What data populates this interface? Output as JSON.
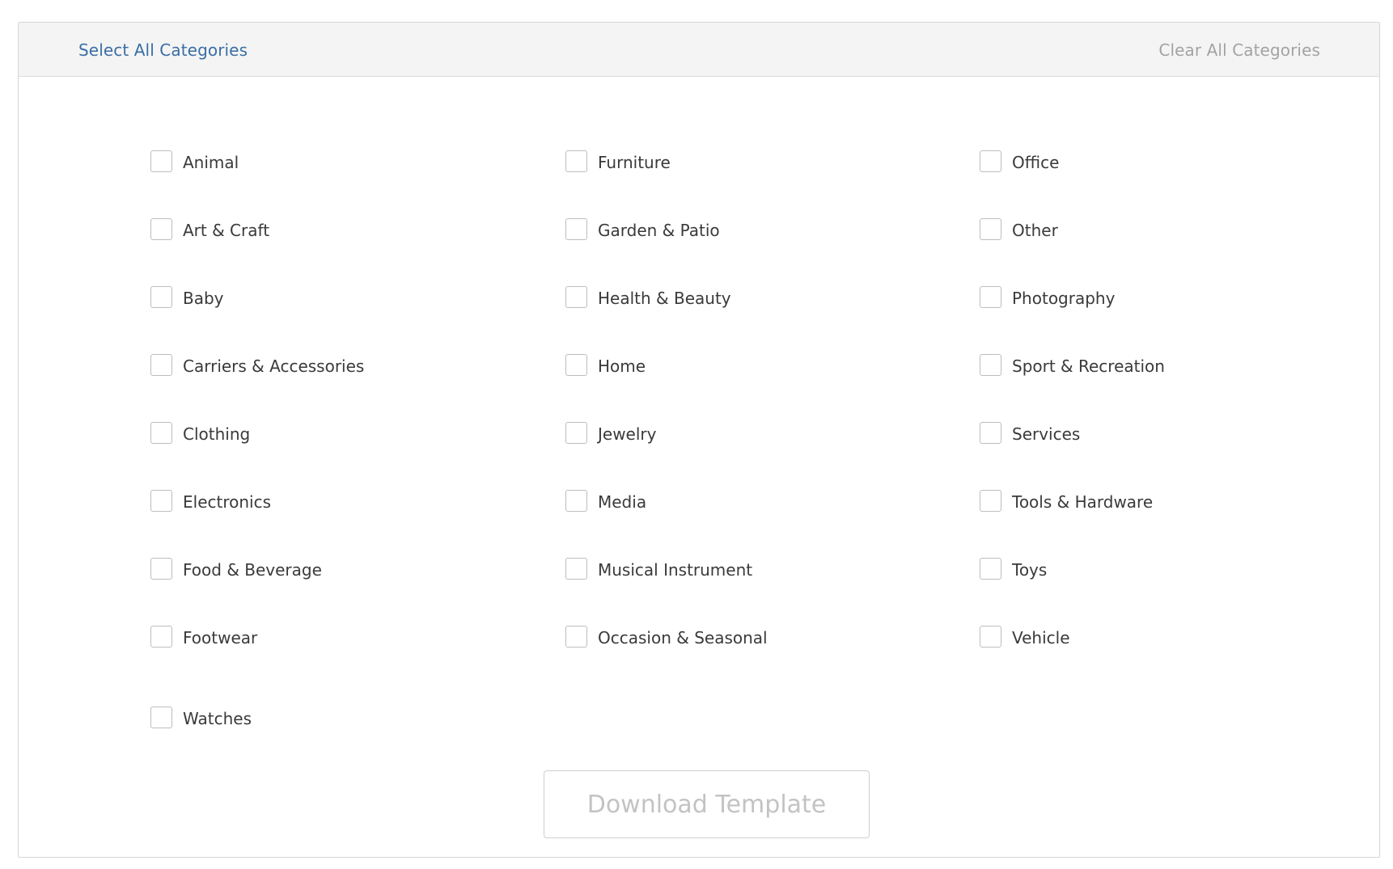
{
  "header": {
    "select_all": "Select All Categories",
    "clear_all": "Clear All Categories"
  },
  "categories": {
    "col1": [
      "Animal",
      "Art & Craft",
      "Baby",
      "Carriers & Accessories",
      "Clothing",
      "Electronics",
      "Food & Beverage",
      "Footwear",
      "Watches"
    ],
    "col2": [
      "Furniture",
      "Garden & Patio",
      "Health & Beauty",
      "Home",
      "Jewelry",
      "Media",
      "Musical Instrument",
      "Occasion & Seasonal"
    ],
    "col3": [
      "Office",
      "Other",
      "Photography",
      "Sport & Recreation",
      "Services",
      "Tools & Hardware",
      "Toys",
      "Vehicle"
    ]
  },
  "footer": {
    "download_label": "Download Template"
  },
  "colors": {
    "link_active": "#3a6ea5",
    "link_disabled": "#a3a3a3",
    "button_disabled_text": "#c3c3c3"
  }
}
